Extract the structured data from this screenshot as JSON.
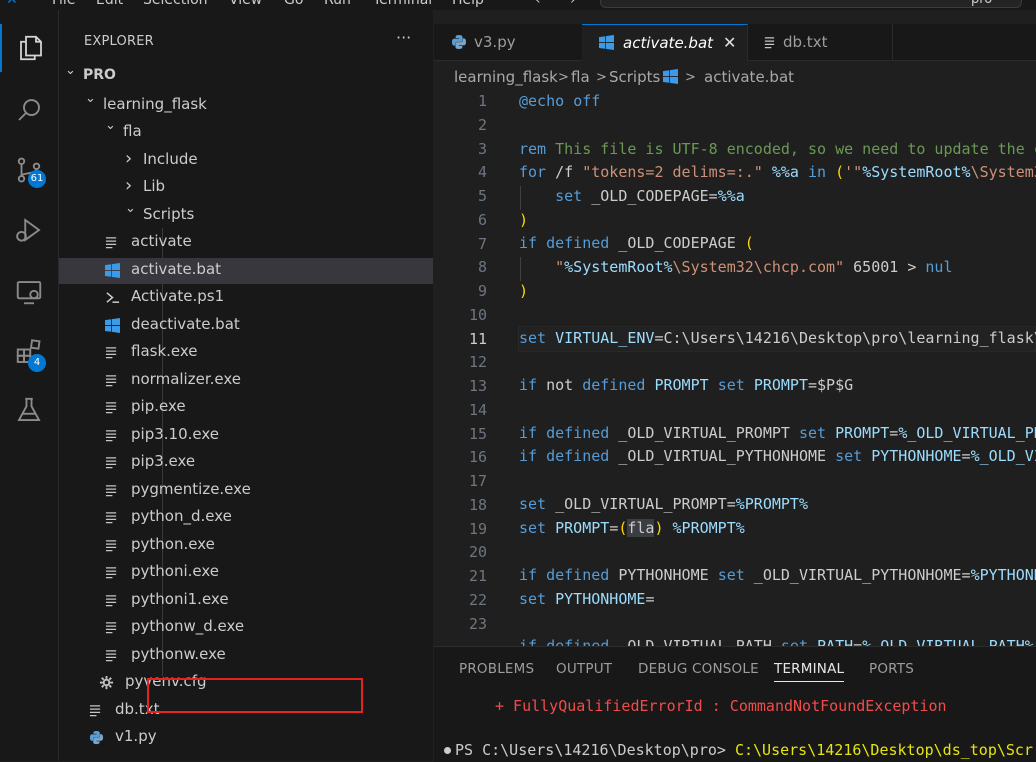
{
  "menubar": {
    "items": [
      "File",
      "Edit",
      "Selection",
      "View",
      "Go",
      "Run",
      "Terminal",
      "Help"
    ],
    "search_text": "pro"
  },
  "activitybar": {
    "source_control_badge": "61",
    "extensions_badge": "4"
  },
  "sidebar": {
    "title": "EXPLORER",
    "more": "···",
    "tree": [
      {
        "label": "PRO",
        "kind": "root"
      },
      {
        "label": "learning_flask",
        "kind": "folder-open"
      },
      {
        "label": "fla",
        "kind": "folder-open"
      },
      {
        "label": "Include",
        "kind": "folder-closed"
      },
      {
        "label": "Lib",
        "kind": "folder-closed"
      },
      {
        "label": "Scripts",
        "kind": "folder-open"
      },
      {
        "label": "activate",
        "kind": "file-text"
      },
      {
        "label": "activate.bat",
        "kind": "file-windows",
        "selected": true
      },
      {
        "label": "Activate.ps1",
        "kind": "file-powershell"
      },
      {
        "label": "deactivate.bat",
        "kind": "file-windows"
      },
      {
        "label": "flask.exe",
        "kind": "file-text"
      },
      {
        "label": "normalizer.exe",
        "kind": "file-text"
      },
      {
        "label": "pip.exe",
        "kind": "file-text"
      },
      {
        "label": "pip3.10.exe",
        "kind": "file-text"
      },
      {
        "label": "pip3.exe",
        "kind": "file-text"
      },
      {
        "label": "pygmentize.exe",
        "kind": "file-text"
      },
      {
        "label": "python_d.exe",
        "kind": "file-text"
      },
      {
        "label": "python.exe",
        "kind": "file-text"
      },
      {
        "label": "pythoni.exe",
        "kind": "file-text"
      },
      {
        "label": "pythoni1.exe",
        "kind": "file-text"
      },
      {
        "label": "pythonw_d.exe",
        "kind": "file-text"
      },
      {
        "label": "pythonw.exe",
        "kind": "file-text"
      },
      {
        "label": "pyvenv.cfg",
        "kind": "file-gear"
      },
      {
        "label": "db.txt",
        "kind": "file-text"
      },
      {
        "label": "v1.py",
        "kind": "file-python"
      }
    ]
  },
  "tabs": [
    {
      "label": "v3.py",
      "icon": "python-icon"
    },
    {
      "label": "activate.bat",
      "icon": "windows-icon",
      "active": true,
      "close": "✕"
    },
    {
      "label": "db.txt",
      "icon": "text-file-icon"
    }
  ],
  "breadcrumb": {
    "parts": [
      "learning_flask",
      "fla",
      "Scripts",
      "activate.bat"
    ],
    "separator": ">"
  },
  "editor": {
    "active_line": 11,
    "line_numbers": [
      "1",
      "2",
      "3",
      "4",
      "5",
      "6",
      "7",
      "8",
      "9",
      "10",
      "11",
      "12",
      "13",
      "14",
      "15",
      "16",
      "17",
      "18",
      "19",
      "20",
      "21",
      "22",
      "23"
    ]
  },
  "panel": {
    "tabs": [
      "PROBLEMS",
      "OUTPUT",
      "DEBUG CONSOLE",
      "TERMINAL",
      "PORTS"
    ],
    "active_tab": "TERMINAL",
    "error_line": "+ FullyQualifiedErrorId : CommandNotFoundException",
    "prompt": "PS C:\\Users\\14216\\Desktop\\pro> ",
    "command": "C:\\Users\\14216\\Desktop\\ds_top\\Scr"
  }
}
